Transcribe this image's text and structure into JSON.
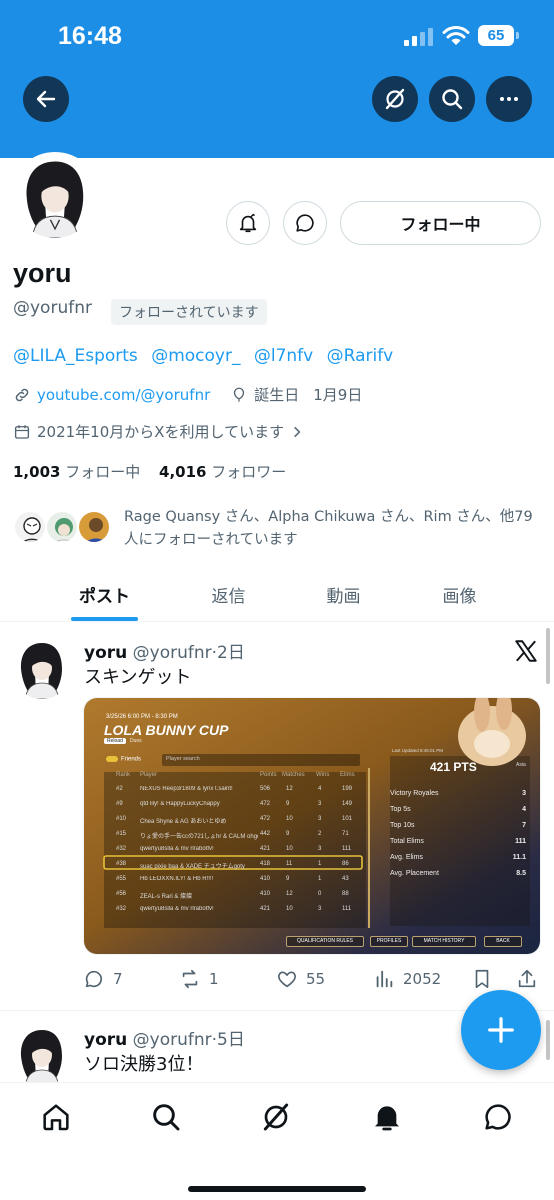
{
  "status_bar": {
    "time": "16:48",
    "battery": "65"
  },
  "header": {
    "back_icon": "arrow-left-icon",
    "grok_icon": "grok-icon",
    "search_icon": "search-icon",
    "more_icon": "more-horizontal-icon",
    "banner_color": "#1d8ee6"
  },
  "profile": {
    "display_name": "yoru",
    "handle": "@yorufnr",
    "follows_you_badge": "フォローされています",
    "follow_button": "フォロー中",
    "bio_mentions": [
      "@LILA_Esports",
      "@mocoyr_",
      "@l7nfv",
      "@Rarifv"
    ],
    "website": "youtube.com/@yorufnr",
    "birthday_label": "誕生日",
    "birthday": "1月9日",
    "joined": "2021年10月からXを利用しています",
    "following_count": "1,003",
    "following_label": "フォロー中",
    "followers_count": "4,016",
    "followers_label": "フォロワー",
    "mutuals_text": "Rage Quansy さん、Alpha Chikuwa さん、Rim さん、他79人にフォローされています"
  },
  "tabs": [
    {
      "label": "ポスト",
      "active": true
    },
    {
      "label": "返信",
      "active": false
    },
    {
      "label": "動画",
      "active": false
    },
    {
      "label": "画像",
      "active": false
    }
  ],
  "posts": [
    {
      "name": "yoru",
      "handle": "@yorufnr",
      "time": "2日",
      "text": "スキンゲット",
      "replies": "7",
      "reposts": "1",
      "likes": "55",
      "views": "2052",
      "media": {
        "date": "3/25/26 6:00 PM - 8:30 PM",
        "title": "LOLA BUNNY CUP",
        "badge": "Reload",
        "mode": "Duos",
        "friends_label": "Friends",
        "search_placeholder": "Player search",
        "columns": [
          "Rank",
          "Player",
          "Points",
          "Matches",
          "Wins",
          "Elims"
        ],
        "rows": [
          {
            "rank": "#2",
            "player": "NEXUS Reep3r1809 & lynx t.saint!",
            "points": "506",
            "matches": "12",
            "wins": "4",
            "elims": "199"
          },
          {
            "rank": "#9",
            "player": "qtd lily! & HappyLuckyChappy",
            "points": "472",
            "matches": "9",
            "wins": "3",
            "elims": "149"
          },
          {
            "rank": "#10",
            "player": "Chea Shyne & AG あおいとゆめ",
            "points": "472",
            "matches": "10",
            "wins": "3",
            "elims": "101"
          },
          {
            "rank": "#15",
            "player": "りょ愛の手一缶ccの721しょhr & CALM ohgeuk",
            "points": "442",
            "matches": "9",
            "wins": "2",
            "elims": "71"
          },
          {
            "rank": "#32",
            "player": "qwertyu8slla & mv rlrabotfv!",
            "points": "421",
            "matches": "10",
            "wins": "3",
            "elims": "111"
          },
          {
            "rank": "#38",
            "player": "suac pixie baa & XADE チュウチムgoty",
            "points": "418",
            "matches": "11",
            "wins": "1",
            "elims": "86"
          },
          {
            "rank": "#55",
            "player": "Hb LEOXXN.ILY! & Hb R!!!!",
            "points": "410",
            "matches": "9",
            "wins": "1",
            "elims": "43"
          },
          {
            "rank": "#56",
            "player": "ZEAL-s Rari & 燦燦",
            "points": "410",
            "matches": "12",
            "wins": "0",
            "elims": "88"
          },
          {
            "rank": "#32",
            "player": "qwertyu8slla & mv rlrabotfv!",
            "points": "421",
            "matches": "10",
            "wins": "3",
            "elims": "111"
          }
        ],
        "region": "Asia",
        "last_updated": "Last Updated 8:45:01 PM",
        "pts": "421 PTS",
        "stats": [
          {
            "label": "Victory Royales",
            "value": "3"
          },
          {
            "label": "Top 5s",
            "value": "4"
          },
          {
            "label": "Top 10s",
            "value": "7"
          },
          {
            "label": "Total Elims",
            "value": "111"
          },
          {
            "label": "Avg. Elims",
            "value": "11.1"
          },
          {
            "label": "Avg. Placement",
            "value": "8.5"
          }
        ],
        "buttons": [
          "QUALIFICATION RULES",
          "PROFILES",
          "MATCH HISTORY",
          "BACK"
        ]
      }
    },
    {
      "name": "yoru",
      "handle": "@yorufnr",
      "time": "5日",
      "text": "ソロ決勝3位！"
    }
  ],
  "colors": {
    "accent": "#1d9bf0",
    "muted": "#536471"
  },
  "fab_icon": "plus-icon",
  "bottom_nav": [
    "home-icon",
    "search-icon",
    "grok-icon",
    "notifications-bell-icon",
    "messages-icon"
  ]
}
